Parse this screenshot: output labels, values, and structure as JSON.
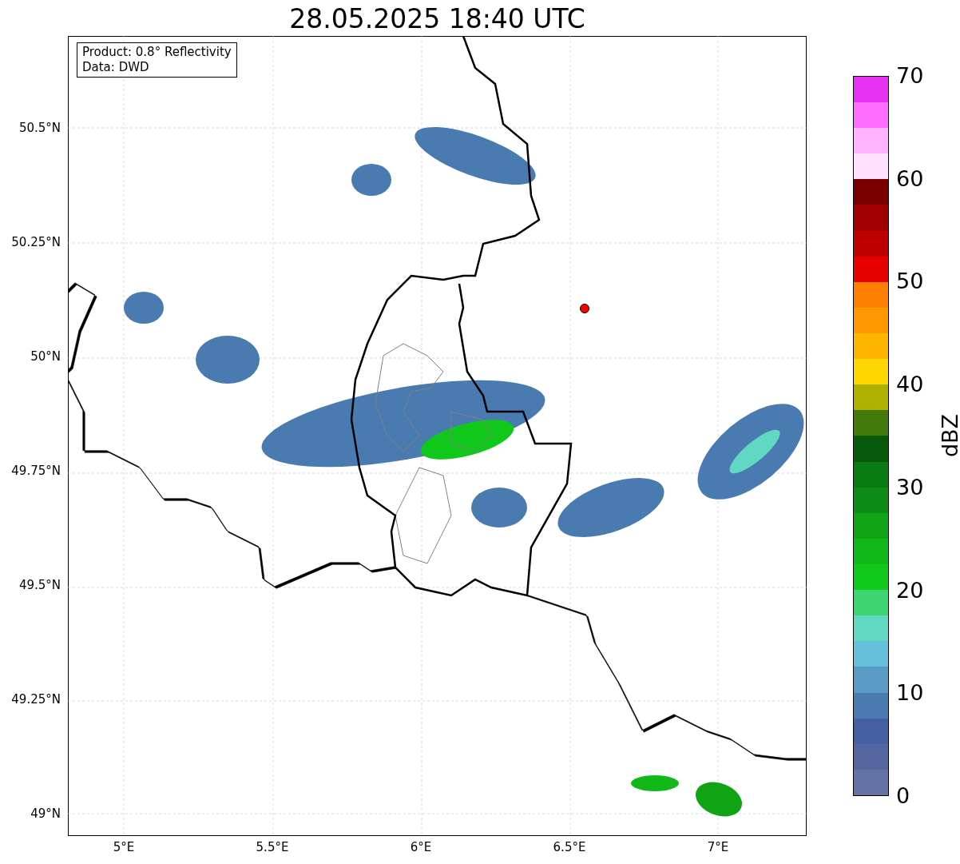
{
  "title": "28.05.2025 18:40 UTC",
  "info_box": {
    "lines": [
      "Product: 0.8° Reflectivity",
      "Data: DWD"
    ]
  },
  "y_ticks": [
    "50.5°N",
    "50.25°N",
    "50°N",
    "49.75°N",
    "49.5°N",
    "49.25°N",
    "49°N"
  ],
  "x_ticks": [
    "5°E",
    "5.5°E",
    "6°E",
    "6.5°E",
    "7°E"
  ],
  "colorbar": {
    "label": "dBZ",
    "ticks": [
      "70",
      "60",
      "50",
      "40",
      "30",
      "20",
      "10",
      "0"
    ],
    "segments": [
      {
        "color": "#6473a6"
      },
      {
        "color": "#5466a0"
      },
      {
        "color": "#4560a2"
      },
      {
        "color": "#4a7bb0"
      },
      {
        "color": "#5b9cc6"
      },
      {
        "color": "#66c0dc"
      },
      {
        "color": "#60d8c4"
      },
      {
        "color": "#3dd472"
      },
      {
        "color": "#10c81a"
      },
      {
        "color": "#10b818"
      },
      {
        "color": "#10a414"
      },
      {
        "color": "#0c8c14"
      },
      {
        "color": "#0a7a12"
      },
      {
        "color": "#08580c"
      },
      {
        "color": "#447a0c"
      },
      {
        "color": "#b0b000"
      },
      {
        "color": "#ffd700"
      },
      {
        "color": "#ffb400"
      },
      {
        "color": "#ff9800"
      },
      {
        "color": "#ff7f00"
      },
      {
        "color": "#e60000"
      },
      {
        "color": "#c00000"
      },
      {
        "color": "#a00000"
      },
      {
        "color": "#7a0000"
      },
      {
        "color": "#ffe0ff"
      },
      {
        "color": "#ffb4ff"
      },
      {
        "color": "#ff6eff"
      },
      {
        "color": "#e632f0"
      }
    ]
  }
}
